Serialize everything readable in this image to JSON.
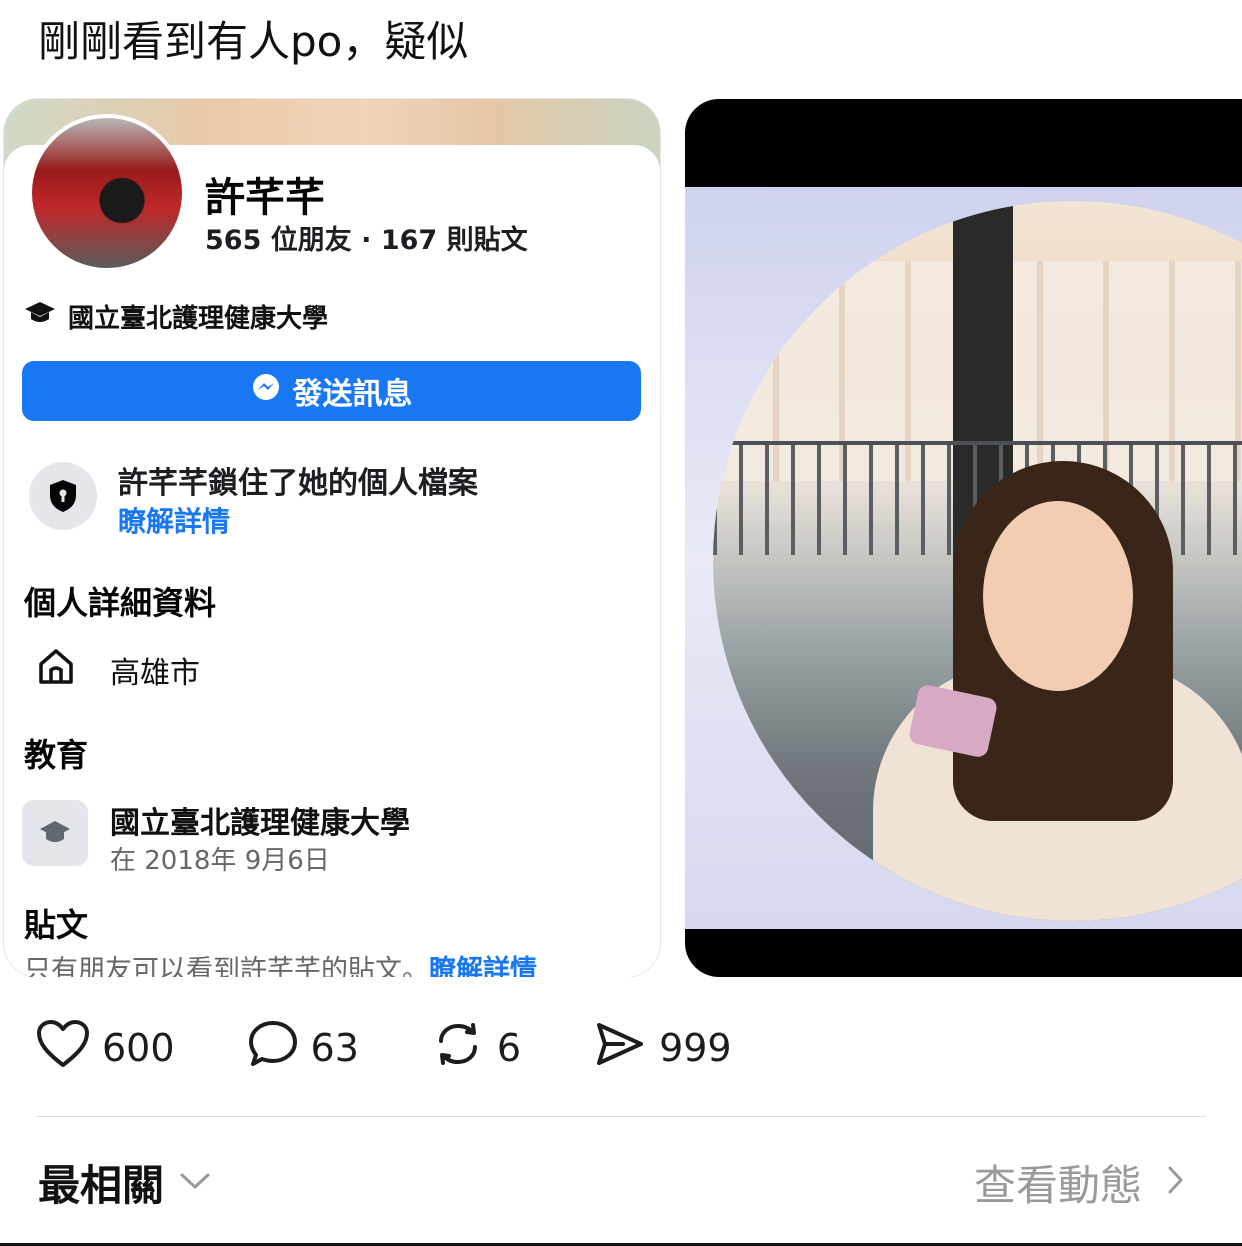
{
  "post": {
    "text": "剛剛看到有人po，疑似"
  },
  "profile_card": {
    "name": "許芊芊",
    "stats": "565 位朋友 · 167 則貼文",
    "school": "國立臺北護理健康大學",
    "message_button": "發送訊息",
    "lock_title": "許芊芊鎖住了她的個人檔案",
    "lock_link": "瞭解詳情",
    "details_title": "個人詳細資料",
    "hometown": "高雄市",
    "education_title": "教育",
    "education_school": "國立臺北護理健康大學",
    "education_date": "在 2018年 9月6日",
    "posts_title": "貼文",
    "posts_note": "只有朋友可以看到許芊芊的貼文。",
    "posts_link": "瞭解詳情"
  },
  "actions": {
    "likes": "600",
    "comments": "63",
    "reposts": "6",
    "shares": "999"
  },
  "footer": {
    "sort_label": "最相關",
    "activity_label": "查看動態"
  },
  "colors": {
    "accent": "#1877f2",
    "muted": "#9a9a9a"
  }
}
